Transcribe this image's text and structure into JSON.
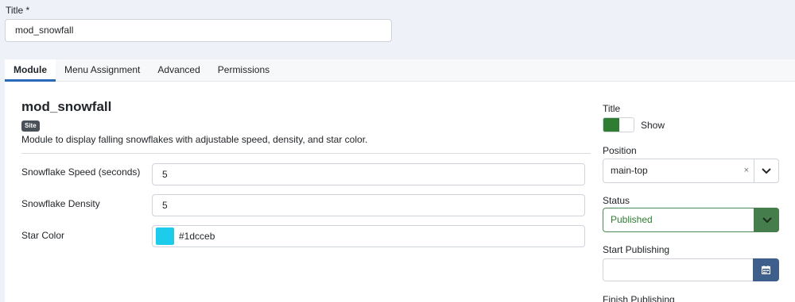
{
  "title_field": {
    "label": "Title *",
    "value": "mod_snowfall"
  },
  "tabs": [
    {
      "label": "Module"
    },
    {
      "label": "Menu Assignment"
    },
    {
      "label": "Advanced"
    },
    {
      "label": "Permissions"
    }
  ],
  "module": {
    "heading": "mod_snowfall",
    "badge": "Site",
    "description": "Module to display falling snowflakes with adjustable speed, density, and star color."
  },
  "fields": [
    {
      "label": "Snowflake Speed (seconds)",
      "value": "5"
    },
    {
      "label": "Snowflake Density",
      "value": "5"
    },
    {
      "label": "Star Color",
      "value": "#1dcceb",
      "swatch_color": "#1dcceb"
    }
  ],
  "sidebar": {
    "title": {
      "label": "Title",
      "toggle_text": "Show",
      "on_color": "#2e7d32"
    },
    "position": {
      "label": "Position",
      "value": "main-top",
      "clear": "×"
    },
    "status": {
      "label": "Status",
      "value": "Published"
    },
    "start_publishing": {
      "label": "Start Publishing",
      "value": ""
    },
    "finish_publishing": {
      "label": "Finish Publishing"
    }
  },
  "colors": {
    "accent": "#2a69b8",
    "success": "#2e7d32",
    "calendar_button": "#3e5f8c"
  }
}
